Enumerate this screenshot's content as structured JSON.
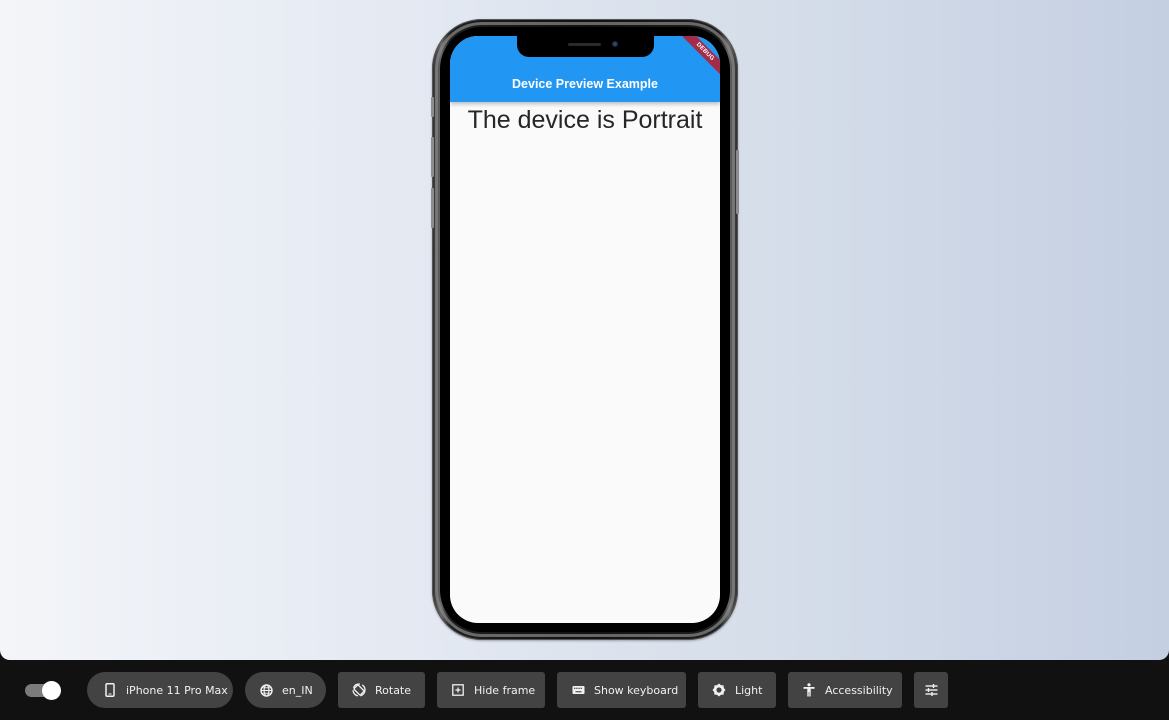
{
  "device_screen": {
    "app_bar_title": "Device Preview Example",
    "debug_banner": "DEBUG",
    "body_text": "The device is Portrait",
    "colors": {
      "app_bar": "#2196f3",
      "debug_banner": "#a32d48"
    }
  },
  "toolbar": {
    "preview_toggle": {
      "enabled": true
    },
    "device_button": {
      "label": "iPhone 11 Pro Max",
      "icon": "phone-icon"
    },
    "locale_button": {
      "label": "en_IN",
      "icon": "globe-icon"
    },
    "rotate_button": {
      "label": "Rotate",
      "icon": "rotate-icon"
    },
    "frame_button": {
      "label": "Hide frame",
      "icon": "frame-icon"
    },
    "keyboard_button": {
      "label": "Show keyboard",
      "icon": "keyboard-icon"
    },
    "theme_button": {
      "label": "Light",
      "icon": "brightness-icon"
    },
    "accessibility_button": {
      "label": "Accessibility",
      "icon": "accessibility-icon"
    },
    "settings_button": {
      "icon": "tune-icon"
    }
  }
}
